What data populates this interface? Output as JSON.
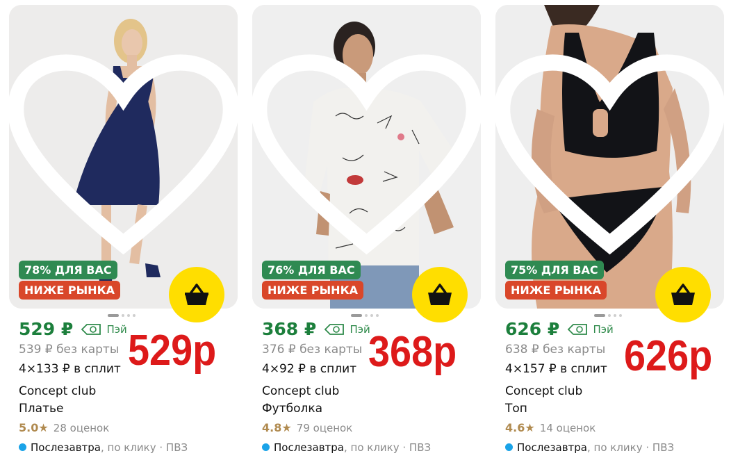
{
  "products": [
    {
      "discount_badge": "78% ДЛЯ ВАС",
      "market_badge": "НИЖЕ РЫНКА",
      "price": "529 ₽",
      "pay_label": "Пэй",
      "no_card_price": "539 ₽ без карты",
      "split": "4×133 ₽ в сплит",
      "brand": "Concept club",
      "type": "Платье",
      "rating": "5.0",
      "star": "★",
      "reviews": "28 оценок",
      "delivery_main": "Послезавтра",
      "delivery_rest": ", по клику · ПВЗ",
      "overlay_price": "529р",
      "icons": [
        "heart-icon",
        "basket-icon",
        "pay-badge-icon"
      ],
      "colors": {
        "garment": "#1f2a5e"
      }
    },
    {
      "discount_badge": "76% ДЛЯ ВАС",
      "market_badge": "НИЖЕ РЫНКА",
      "price": "368 ₽",
      "pay_label": "Пэй",
      "no_card_price": "376 ₽ без карты",
      "split": "4×92 ₽ в сплит",
      "brand": "Concept club",
      "type": "Футболка",
      "rating": "4.8",
      "star": "★",
      "reviews": "79 оценок",
      "delivery_main": "Послезавтра",
      "delivery_rest": ", по клику · ПВЗ",
      "overlay_price": "368р",
      "icons": [
        "heart-icon",
        "basket-icon",
        "pay-badge-icon"
      ],
      "colors": {
        "garment": "#f2f1ee"
      }
    },
    {
      "discount_badge": "75% ДЛЯ ВАС",
      "market_badge": "НИЖЕ РЫНКА",
      "price": "626 ₽",
      "pay_label": "Пэй",
      "no_card_price": "638 ₽ без карты",
      "split": "4×157 ₽ в сплит",
      "brand": "Concept club",
      "type": "Топ",
      "rating": "4.6",
      "star": "★",
      "reviews": "14 оценок",
      "delivery_main": "Послезавтра",
      "delivery_rest": ", по клику · ПВЗ",
      "overlay_price": "626р",
      "icons": [
        "heart-icon",
        "basket-icon",
        "pay-badge-icon"
      ],
      "colors": {
        "garment": "#121317"
      }
    }
  ],
  "colors": {
    "price_green": "#1c7f3c",
    "discount_green": "#2f8a52",
    "market_red": "#d9472a",
    "cart_yellow": "#ffde00",
    "overlay_red": "#dd1a1a",
    "rating_gold": "#b08a4f",
    "delivery_blue": "#1aa3e8"
  }
}
